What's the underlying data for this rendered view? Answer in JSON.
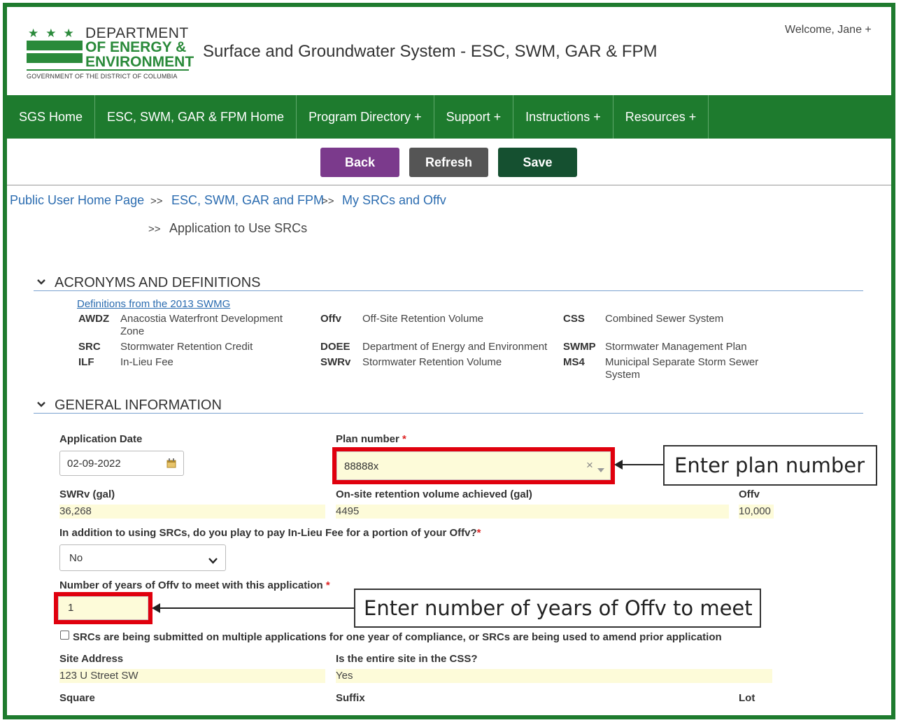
{
  "header": {
    "logo": {
      "line1": "DEPARTMENT",
      "line2": "OF ENERGY &",
      "line3": "ENVIRONMENT",
      "line4": "GOVERNMENT OF THE DISTRICT OF COLUMBIA"
    },
    "site_title": "Surface and Groundwater System - ESC, SWM, GAR & FPM",
    "welcome": "Welcome, Jane +"
  },
  "nav": {
    "items": [
      {
        "label": "SGS Home"
      },
      {
        "label": "ESC, SWM, GAR & FPM Home"
      },
      {
        "label": "Program Directory +"
      },
      {
        "label": "Support +"
      },
      {
        "label": "Instructions +"
      },
      {
        "label": "Resources +"
      }
    ]
  },
  "toolbar": {
    "back_label": "Back",
    "refresh_label": "Refresh",
    "save_label": "Save"
  },
  "breadcrumb": {
    "sep": ">>",
    "items": [
      "Public User Home Page",
      "ESC, SWM, GAR and FPM",
      "My SRCs and Offv"
    ],
    "current": "Application to Use SRCs"
  },
  "acronyms": {
    "heading": "ACRONYMS AND DEFINITIONS",
    "link": "Definitions from the 2013 SWMG",
    "entries": [
      {
        "abbr": "AWDZ",
        "def": "Anacostia Waterfront Development Zone"
      },
      {
        "abbr": "SRC",
        "def": "Stormwater Retention Credit"
      },
      {
        "abbr": "ILF",
        "def": "In-Lieu Fee"
      },
      {
        "abbr": "Offv",
        "def": "Off-Site Retention Volume"
      },
      {
        "abbr": "DOEE",
        "def": "Department of Energy and Environment"
      },
      {
        "abbr": "SWRv",
        "def": "Stormwater Retention Volume"
      },
      {
        "abbr": "CSS",
        "def": "Combined Sewer System"
      },
      {
        "abbr": "SWMP",
        "def": "Stormwater Management Plan"
      },
      {
        "abbr": "MS4",
        "def": "Municipal Separate Storm Sewer System"
      }
    ]
  },
  "general": {
    "heading": "GENERAL INFORMATION",
    "application_date": {
      "label": "Application Date",
      "value": "02-09-2022"
    },
    "plan_number": {
      "label": "Plan number",
      "required": "*",
      "value": "88888x"
    },
    "swrv": {
      "label": "SWRv (gal)",
      "value": "36,268"
    },
    "onsite": {
      "label": "On-site retention volume achieved (gal)",
      "value": "4495"
    },
    "offv": {
      "label": "Offv",
      "value": "10,000"
    },
    "ilf_question": {
      "label": "In addition to using SRCs, do you play to pay In-Lieu Fee for a portion of your Offv?",
      "required": "*",
      "value": "No"
    },
    "years": {
      "label": "Number of years of Offv to meet with this application",
      "required": "*",
      "value": "1"
    },
    "multi_app_checkbox": {
      "label": "SRCs are being submitted on multiple applications for one year of compliance, or SRCs are  being used to amend prior application",
      "checked": false
    },
    "site_address": {
      "label": "Site Address",
      "value": "123 U Street SW"
    },
    "in_css": {
      "label": "Is the entire site in the CSS?",
      "value": "Yes"
    },
    "square": {
      "label": "Square"
    },
    "suffix": {
      "label": "Suffix"
    },
    "lot": {
      "label": "Lot"
    }
  },
  "callouts": {
    "plan": "Enter plan number",
    "years": "Enter number of years of Offv to meet"
  },
  "colors": {
    "brand_green": "#1e7b2e",
    "back_purple": "#7b3a8c",
    "save_dark_green": "#155030",
    "highlight_red": "#e0000d",
    "readonly_yellow": "#fdfbd9"
  }
}
